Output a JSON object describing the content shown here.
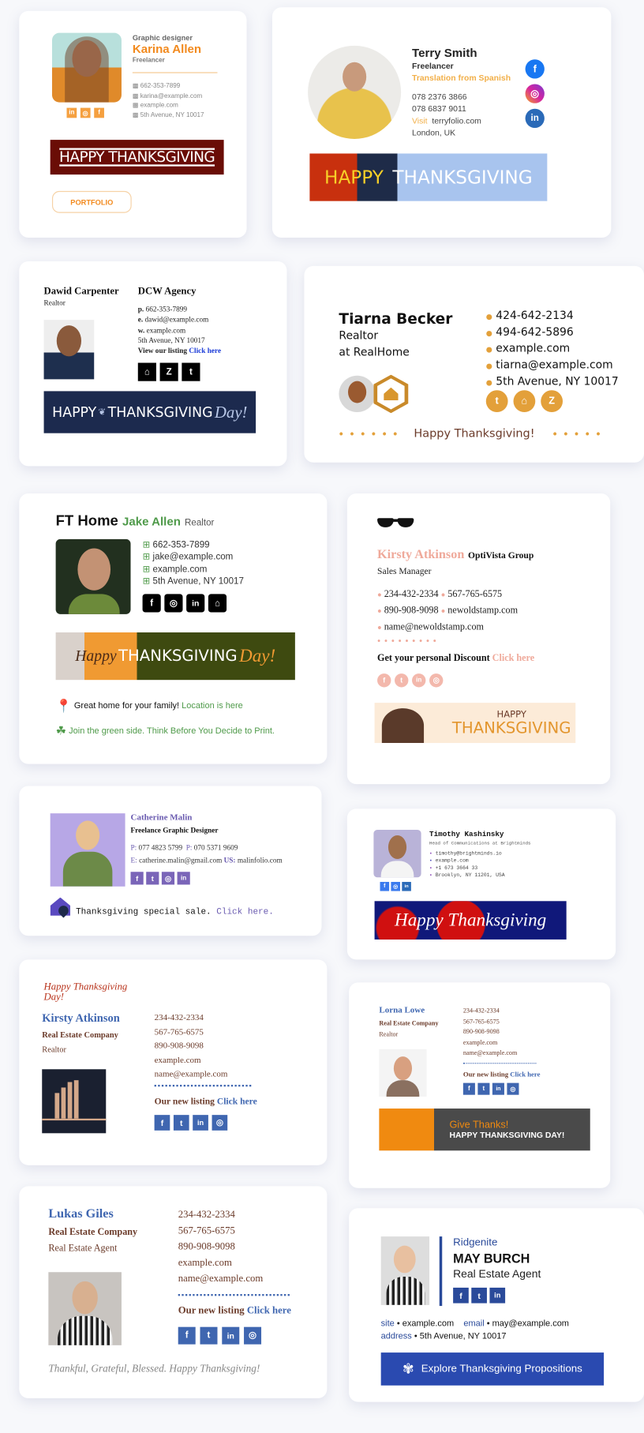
{
  "colors": {
    "orange": "#f28a1e",
    "green": "#4f9a4a",
    "purple": "#6a5bb0",
    "blue": "#3f66b0",
    "pink": "#efa99a",
    "gold": "#e3a03a",
    "brown": "#6b3b2a",
    "navy": "#1e2a4a"
  },
  "card1": {
    "role": "Graphic designer",
    "name": "Karina Allen",
    "sub": "Freelancer",
    "phone": "662-353-7899",
    "email": "karina@example.com",
    "web": "example.com",
    "address": "5th Avenue, NY 10017",
    "social": [
      "in",
      "◎",
      "f"
    ],
    "banner": "HAPPY THANKSGIVING",
    "button": "PORTFOLIO"
  },
  "card2": {
    "name": "Terry Smith",
    "role": "Freelancer",
    "tagline": "Translation from Spanish",
    "phone1": "078 2376 3866",
    "phone2": "078 6837 9011",
    "visit_label": "Visit",
    "web": "terryfolio.com",
    "location": "London, UK",
    "banner_left": "HAPPY",
    "banner_right": "THANKSGIVING",
    "social": [
      "f",
      "◎",
      "in"
    ]
  },
  "card3": {
    "name": "Dawid Carpenter",
    "role": "Realtor",
    "company": "DCW Agency",
    "phone_label": "p.",
    "phone": "662-353-7899",
    "email_label": "e.",
    "email": "dawid@example.com",
    "web_label": "w.",
    "web": "example.com",
    "address": "5th Avenue, NY 10017",
    "listing_label": "View our listing",
    "listing_link": "Click here",
    "banner_a": "HAPPY",
    "banner_b": "THANKSGIVING",
    "banner_c": "Day!"
  },
  "card4": {
    "name": "Tiarna Becker",
    "role": "Realtor",
    "company": "at RealHome",
    "lines": [
      "424-642-2134",
      "494-642-5896",
      "example.com",
      "tiarna@example.com",
      "5th Avenue, NY 10017"
    ],
    "footer": "Happy Thanksgiving!"
  },
  "card5": {
    "company": "FT Home",
    "name": "Jake Allen",
    "role": "Realtor",
    "phone": "662-353-7899",
    "email": "jake@example.com",
    "web": "example.com",
    "address": "5th Avenue, NY 10017",
    "banner_a": "Happy",
    "banner_b": "THANKSGIVING",
    "banner_c": "Day!",
    "note1": "Great home for your family!",
    "note1_link": "Location is here",
    "note2": "Join the green side. Think Before You Decide to Print."
  },
  "card6": {
    "name": "Kirsty Atkinson",
    "company": "OptiVista Group",
    "role": "Sales Manager",
    "phone1": "234-432-2334",
    "phone2": "567-765-6575",
    "phone3": "890-908-9098",
    "web": "newoldstamp.com",
    "email": "name@newoldstamp.com",
    "discount": "Get your personal Discount",
    "discount_link": "Click here",
    "banner_a": "HAPPY",
    "banner_b": "THANKSGIVING"
  },
  "card7": {
    "name": "Catherine Malin",
    "role": "Freelance Graphic Designer",
    "p_label": "P:",
    "phone1": "077 4823 5799",
    "phone2": "070 5371 9609",
    "e_label": "E:",
    "email": "catherine.malin@gmail.com",
    "us_label": "US:",
    "web": "malinfolio.com",
    "sale": "Thanksgiving special sale.",
    "sale_link": "Click here."
  },
  "card8": {
    "name": "Timothy Kashinsky",
    "role": "Head of Communications at Brightminds",
    "email": "timothy@brightminds.io",
    "web": "example.com",
    "phone": "+1 673 3664 33",
    "address": "Brooklyn, NY 11201, USA",
    "banner": "Happy Thanksgiving"
  },
  "card9": {
    "greeting": "Happy Thanksgiving Day!",
    "name": "Kirsty Atkinson",
    "company": "Real Estate Company",
    "role": "Realtor",
    "lines": [
      "234-432-2334",
      "567-765-6575",
      "890-908-9098",
      "example.com",
      "name@example.com"
    ],
    "listing": "Our new listing",
    "listing_link": "Click here"
  },
  "card10": {
    "name": "Lorna Lowe",
    "company": "Real Estate Company",
    "role": "Realtor",
    "lines": [
      "234-432-2334",
      "567-765-6575",
      "890-908-9098",
      "example.com",
      "name@example.com"
    ],
    "listing": "Our new listing",
    "listing_link": "Click here",
    "banner_a": "Give Thanks!",
    "banner_b": "HAPPY THANKSGIVING DAY!"
  },
  "card11": {
    "name": "Lukas Giles",
    "company": "Real Estate Company",
    "role": "Real Estate Agent",
    "lines": [
      "234-432-2334",
      "567-765-6575",
      "890-908-9098",
      "example.com",
      "name@example.com"
    ],
    "listing": "Our new listing",
    "listing_link": "Click here",
    "footer": "Thankful, Grateful, Blessed. Happy Thanksgiving!"
  },
  "card12": {
    "company": "Ridgenite",
    "name": "MAY BURCH",
    "role": "Real Estate Agent",
    "site_label": "site",
    "site": "example.com",
    "email_label": "email",
    "email": "may@example.com",
    "address_label": "address",
    "address": "5th Avenue, NY 10017",
    "button": "Explore Thanksgiving Propositions"
  }
}
